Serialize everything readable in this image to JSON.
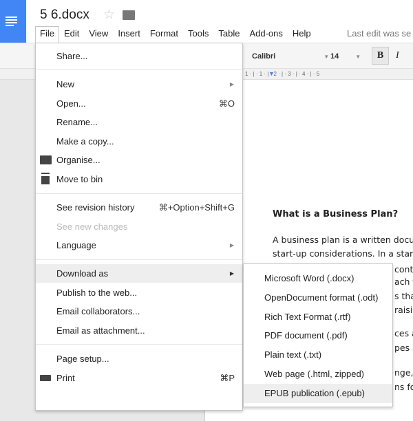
{
  "doc": {
    "title": "5 6.docx",
    "last_edit": "Last edit was se"
  },
  "menubar": [
    "File",
    "Edit",
    "View",
    "Insert",
    "Format",
    "Tools",
    "Table",
    "Add-ons",
    "Help"
  ],
  "toolbar": {
    "font": "Calibri",
    "size": "14",
    "bold": "B",
    "italic": "I"
  },
  "ruler": "1 · | · 1 · | · 2 · | · 3 · | · 4 · | · 5",
  "document": {
    "heading": "What is a Business Plan?",
    "lines": [
      "A business plan is a written docum",
      "start-up considerations.  In a start"
    ],
    "fragments": [
      "cont",
      "ach t",
      "s that",
      "raisin",
      "ces ar",
      "pes s",
      "nge,",
      "ns for"
    ]
  },
  "file_menu": {
    "share": "Share...",
    "new": "New",
    "open": "Open...",
    "open_sc": "⌘O",
    "rename": "Rename...",
    "copy": "Make a copy...",
    "organise": "Organise...",
    "bin": "Move to bin",
    "revision": "See revision history",
    "revision_sc": "⌘+Option+Shift+G",
    "new_changes": "See new changes",
    "language": "Language",
    "download": "Download as",
    "publish": "Publish to the web...",
    "email_collab": "Email collaborators...",
    "email_attach": "Email as attachment...",
    "page_setup": "Page setup...",
    "print": "Print",
    "print_sc": "⌘P"
  },
  "download_menu": [
    "Microsoft Word (.docx)",
    "OpenDocument format (.odt)",
    "Rich Text Format (.rtf)",
    "PDF document (.pdf)",
    "Plain text (.txt)",
    "Web page (.html, zipped)",
    "EPUB publication (.epub)"
  ],
  "colors": {
    "brand": "#4285f4",
    "highlight": "#eeeeee"
  }
}
